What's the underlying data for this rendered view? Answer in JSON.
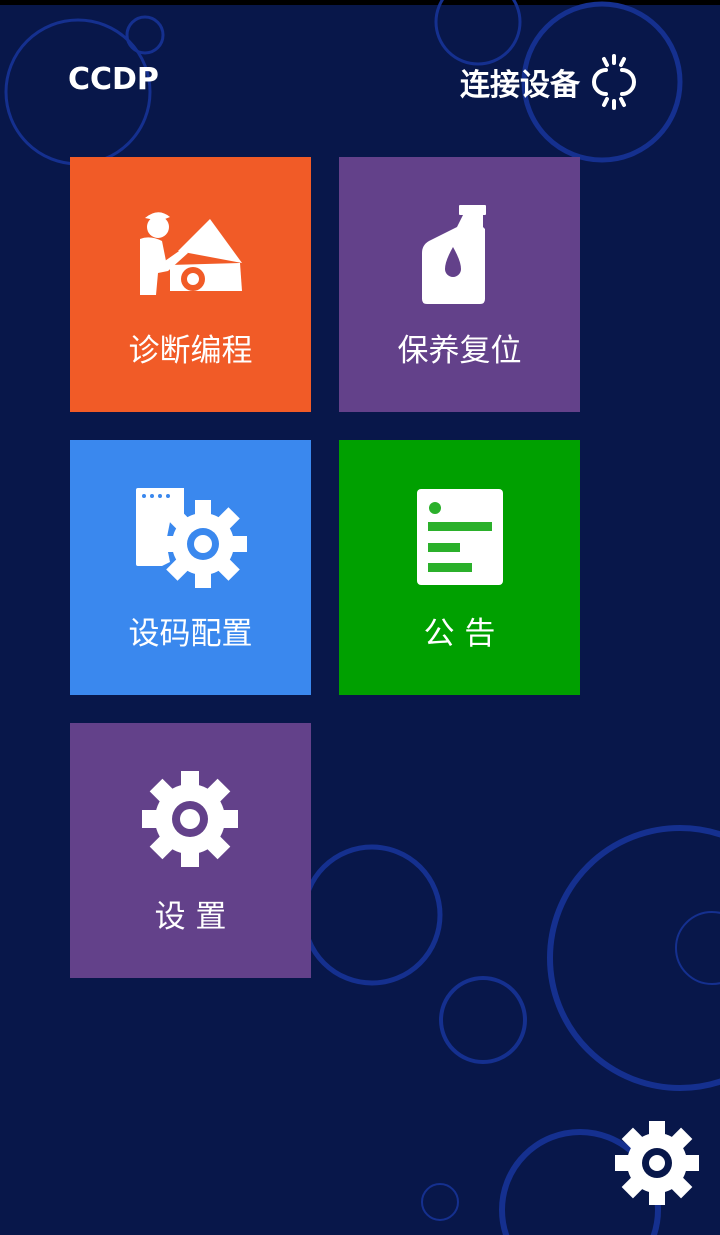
{
  "header": {
    "title": "CCDP",
    "connect_label": "连接设备"
  },
  "tiles": [
    {
      "label": "诊断编程",
      "color": "#f15b27",
      "icon": "mechanic-car-icon"
    },
    {
      "label": "保养复位",
      "color": "#63418a",
      "icon": "oil-bottle-icon"
    },
    {
      "label": "设码配置",
      "color": "#3a88ee",
      "icon": "code-gear-icon"
    },
    {
      "label": "公 告",
      "color": "#00a000",
      "icon": "notice-document-icon"
    },
    {
      "label": "设 置",
      "color": "#63418a",
      "icon": "settings-gear-icon"
    }
  ],
  "colors": {
    "background": "#08174a",
    "circle_stroke": "#15308f"
  }
}
